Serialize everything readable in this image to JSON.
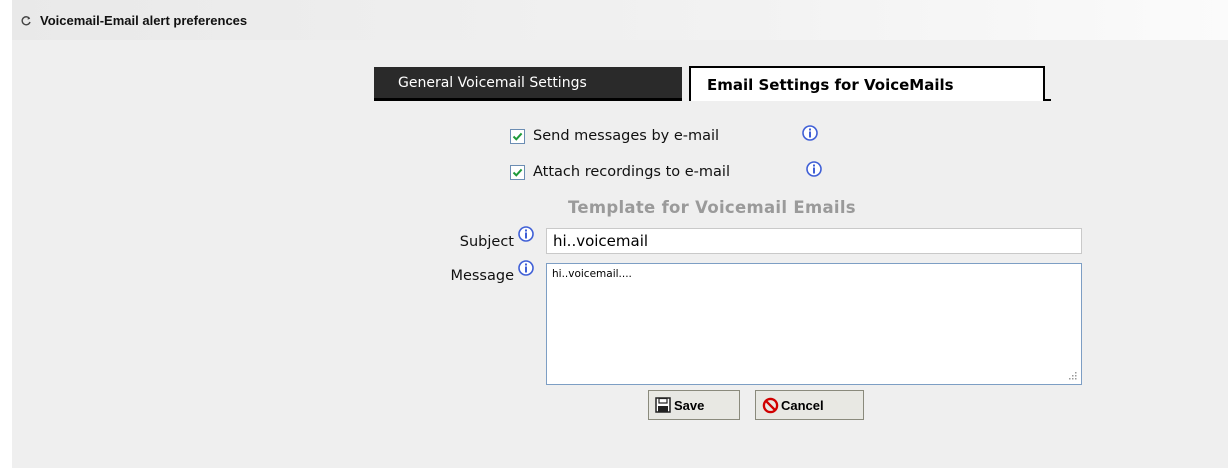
{
  "header": {
    "title": "Voicemail-Email alert preferences",
    "icon": "refresh-icon"
  },
  "tabs": [
    {
      "label": "General Voicemail Settings",
      "active": false
    },
    {
      "label": "Email Settings for VoiceMails",
      "active": true
    }
  ],
  "options": {
    "send_by_email": {
      "label": "Send messages by e-mail",
      "checked": true
    },
    "attach_recordings": {
      "label": "Attach recordings to e-mail",
      "checked": true
    }
  },
  "template": {
    "title": "Template for Voicemail Emails",
    "subject_label": "Subject",
    "subject_value": "hi..voicemail",
    "message_label": "Message",
    "message_value": "hi..voicemail...."
  },
  "buttons": {
    "save_label": "Save",
    "cancel_label": "Cancel"
  },
  "colors": {
    "panel_bg": "#efefef",
    "info_icon": "#3f5fd6",
    "check_green": "#1f9a3a",
    "cancel_red": "#d00000",
    "template_title": "#9a9a9a"
  }
}
